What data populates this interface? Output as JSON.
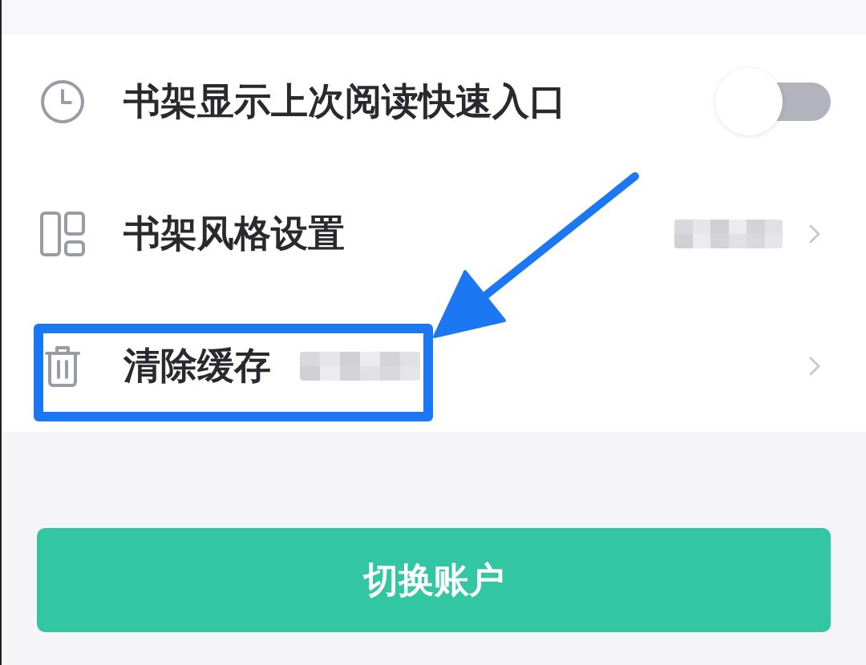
{
  "settings": {
    "rows": [
      {
        "kind": "toggle",
        "label": "书架显示上次阅读快速入口",
        "on": false,
        "highlighted": false
      },
      {
        "kind": "link",
        "label": "书架风格设置",
        "blurred_value": true,
        "value_beside_label": false,
        "highlighted": false
      },
      {
        "kind": "link",
        "label": "清除缓存",
        "blurred_value": true,
        "value_beside_label": true,
        "highlighted": true
      }
    ]
  },
  "switch_account_button": {
    "label": "切换账户"
  }
}
